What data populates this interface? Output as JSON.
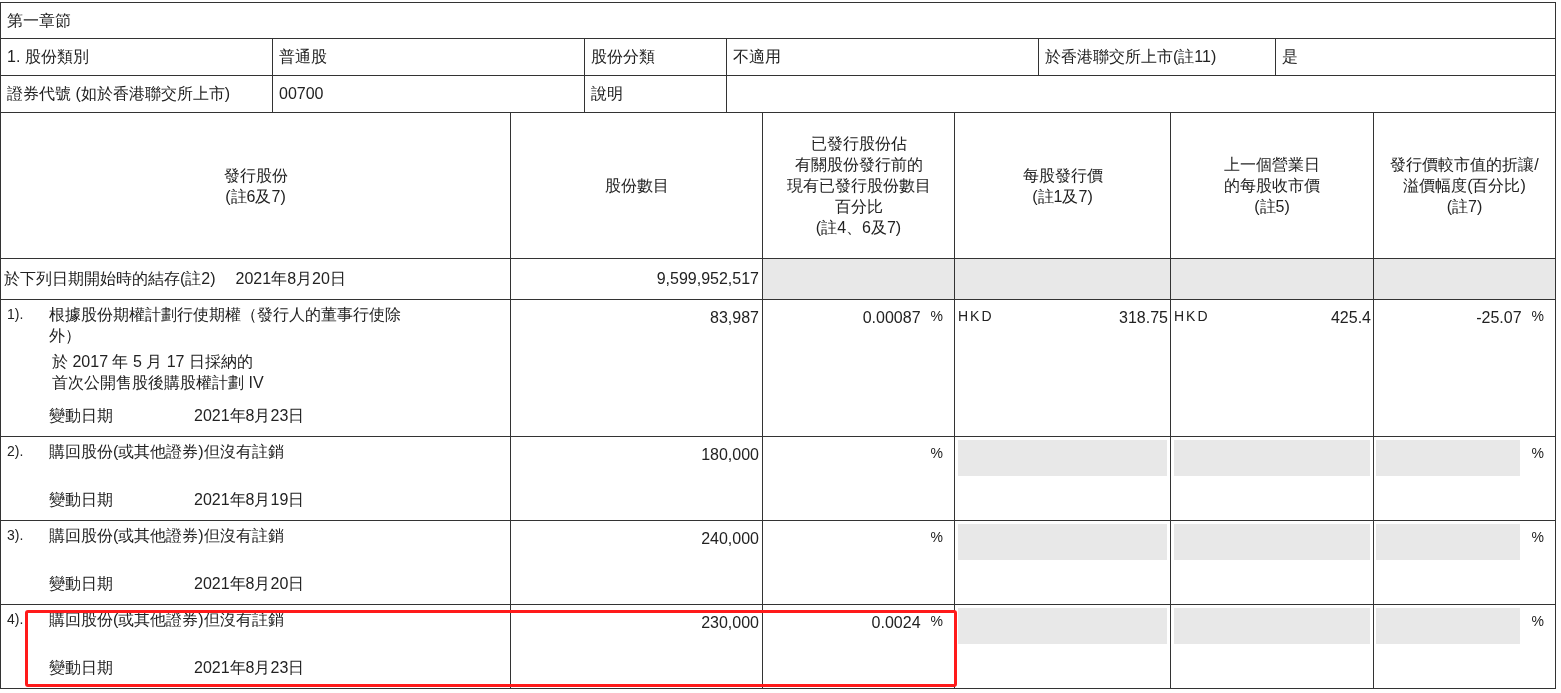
{
  "section_title": "第一章節",
  "info_rows": [
    {
      "cells": [
        {
          "text": "1. 股份類別"
        },
        {
          "text": "普通股"
        },
        {
          "text": "股份分類"
        },
        {
          "text": "不適用"
        },
        {
          "text": "於香港聯交所上市(註11)"
        },
        {
          "text": "是"
        }
      ]
    },
    {
      "cells": [
        {
          "text": "證券代號 (如於香港聯交所上市)"
        },
        {
          "text": "00700"
        },
        {
          "text": "說明"
        }
      ]
    }
  ],
  "columns": [
    [
      "發行股份",
      "(註6及7)"
    ],
    [
      "股份數目"
    ],
    [
      "已發行股份佔",
      "有關股份發行前的",
      "現有已發行股份數目",
      "百分比",
      "(註4、6及7)"
    ],
    [
      "每股發行價",
      "(註1及7)"
    ],
    [
      "上一個營業日",
      "的每股收市價",
      "(註5)"
    ],
    [
      "發行價較市值的折讓/",
      "溢價幅度(百分比)",
      "(註7)"
    ]
  ],
  "opening_balance": {
    "label": "於下列日期開始時的結存(註2)",
    "date": "2021年8月20日",
    "shares": "9,599,952,517"
  },
  "rows": [
    {
      "kind": "priced",
      "index": "1).",
      "description": "根據股份期權計劃行使期權（發行人的董事行使除外）",
      "sub_description": [
        "於 2017 年 5 月 17 日採納的",
        "首次公開售股後購股權計劃 IV"
      ],
      "date_label": "變動日期",
      "date": "2021年8月23日",
      "shares": "83,987",
      "percentage": "0.00087",
      "percentage_unit": "%",
      "issue_price_currency": "HKD",
      "issue_price": "318.75",
      "close_price_currency": "HKD",
      "close_price": "425.4",
      "discount": "-25.07",
      "discount_unit": "%",
      "highlighted": false
    },
    {
      "kind": "unpriced",
      "index": "2).",
      "description": "購回股份(或其他證券)但沒有註銷",
      "date_label": "變動日期",
      "date": "2021年8月19日",
      "shares": "180,000",
      "percentage_unit": "%",
      "discount_unit": "%",
      "highlighted": false
    },
    {
      "kind": "unpriced",
      "index": "3).",
      "description": "購回股份(或其他證券)但沒有註銷",
      "date_label": "變動日期",
      "date": "2021年8月20日",
      "shares": "240,000",
      "percentage_unit": "%",
      "discount_unit": "%",
      "highlighted": false
    },
    {
      "kind": "unpriced",
      "index": "4).",
      "description": "購回股份(或其他證券)但沒有註銷",
      "date_label": "變動日期",
      "date": "2021年8月23日",
      "shares": "230,000",
      "percentage": "0.0024",
      "percentage_unit": "%",
      "discount_unit": "%",
      "highlighted": true
    }
  ]
}
